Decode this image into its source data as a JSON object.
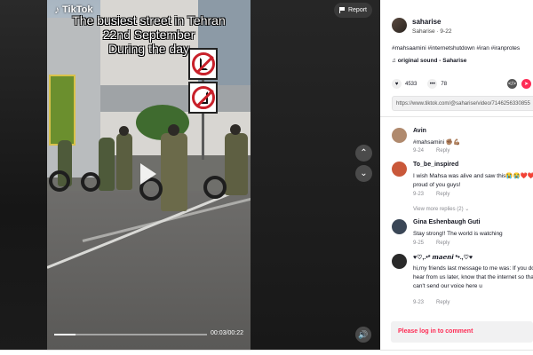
{
  "video": {
    "brand": "TikTok",
    "overlay_lines": [
      "The busiest street in Tehran",
      "22nd September",
      "During the day"
    ],
    "time": "00:03/00:22",
    "progress": 0.14
  },
  "controls": {
    "report_label": "Report"
  },
  "author": {
    "name": "saharise",
    "subline": "Saharise · 9-22"
  },
  "caption": "#mahsaamini #internetshutdown #iran #iranprotes",
  "sound": "original sound - Saharise",
  "stats": {
    "likes": "4533",
    "comments": "78"
  },
  "share_url": "https://www.tiktok.com/@saharise/video/7146256330855",
  "comments": [
    {
      "name": "Avin",
      "text": "#mahsamini ✊🏽💪🏽",
      "date": "9-24",
      "reply": "Reply",
      "avatar_color": "#b08a6e"
    },
    {
      "name": "To_be_inspired",
      "text": "I wish Mahsa was alive and saw this😭😭❤️❤️ is proud of you guys!",
      "date": "9-23",
      "reply": "Reply",
      "avatar_color": "#c9583a"
    },
    {
      "name": "Gina Eshenbaugh Guti",
      "text": "Stay strong!! The world is watching",
      "date": "9-25",
      "reply": "Reply",
      "avatar_color": "#3a4656"
    },
    {
      "name": "♥♡,.•* 𝙢𝙖𝙚𝙣𝙞 *•.,♡♥",
      "text": "hi,my friends last message to me was: If you don't hear from us later, know that the internet so that we can't send our voice here u",
      "date": "9-23",
      "reply": "Reply",
      "avatar_color": "#2a2a2a"
    }
  ],
  "view_more": "View more replies (2) ⌄",
  "login_prompt": "Please log in to comment",
  "colors": {
    "accent": "#fe2c55",
    "stage": "#1e1e1e"
  }
}
